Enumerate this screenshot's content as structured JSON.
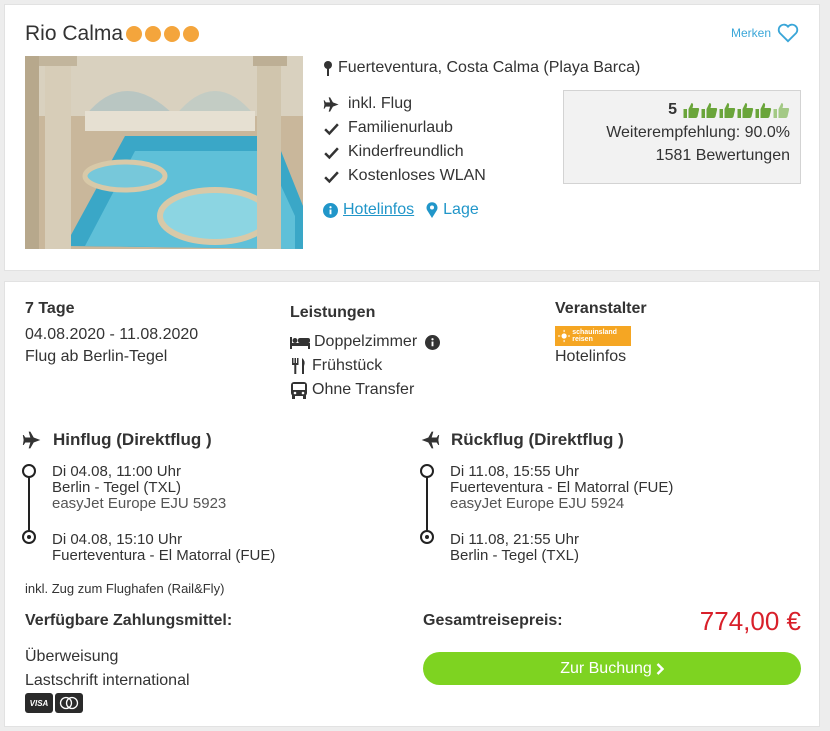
{
  "hotel": {
    "name": "Rio Calma",
    "star_count": 4,
    "merken_label": "Merken",
    "location": "Fuerteventura, Costa Calma (Playa Barca)",
    "features": [
      "inkl. Flug",
      "Familienurlaub",
      "Kinderfreundlich",
      "Kostenloses WLAN"
    ],
    "links": {
      "hotelinfos": "Hotelinfos",
      "lage": "Lage"
    },
    "rating": {
      "score": "5",
      "thumbs": 6,
      "recommendation": "Weiterempfehlung: 90.0%",
      "reviews": "1581 Bewertungen"
    }
  },
  "offer": {
    "duration": "7 Tage",
    "dates": "04.08.2020 - 11.08.2020",
    "departure": "Flug ab Berlin-Tegel",
    "services_title": "Leistungen",
    "services": [
      "Doppelzimmer",
      "Frühstück",
      "Ohne Transfer"
    ],
    "operator_title": "Veranstalter",
    "operator_logo_text": "schauinsland reisen",
    "operator_link": "Hotelinfos",
    "outbound": {
      "title": "Hinflug (Direktflug )",
      "dep_time": "Di 04.08, 11:00 Uhr",
      "dep_airport": "Berlin - Tegel (TXL)",
      "carrier": "easyJet Europe EJU 5923",
      "arr_time": "Di 04.08, 15:10 Uhr",
      "arr_airport": "Fuerteventura - El Matorral (FUE)"
    },
    "inbound": {
      "title": "Rückflug (Direktflug )",
      "dep_time": "Di 11.08, 15:55 Uhr",
      "dep_airport": "Fuerteventura - El Matorral (FUE)",
      "carrier": "easyJet Europe EJU 5924",
      "arr_time": "Di 11.08, 21:55 Uhr",
      "arr_airport": "Berlin - Tegel (TXL)"
    },
    "rail_note": "inkl. Zug zum Flughafen (Rail&Fly)",
    "payment_title": "Verfügbare Zahlungsmittel:",
    "payment_methods": [
      "Überweisung",
      "Lastschrift international"
    ],
    "card_visa": "VISA",
    "total_label": "Gesamtreisepreis:",
    "total_price": "774,00 €",
    "book_label": "Zur Buchung"
  },
  "colors": {
    "accent": "#3aa6d8",
    "price": "#d8202a",
    "button": "#7ed321",
    "stars": "#f4a53c"
  }
}
